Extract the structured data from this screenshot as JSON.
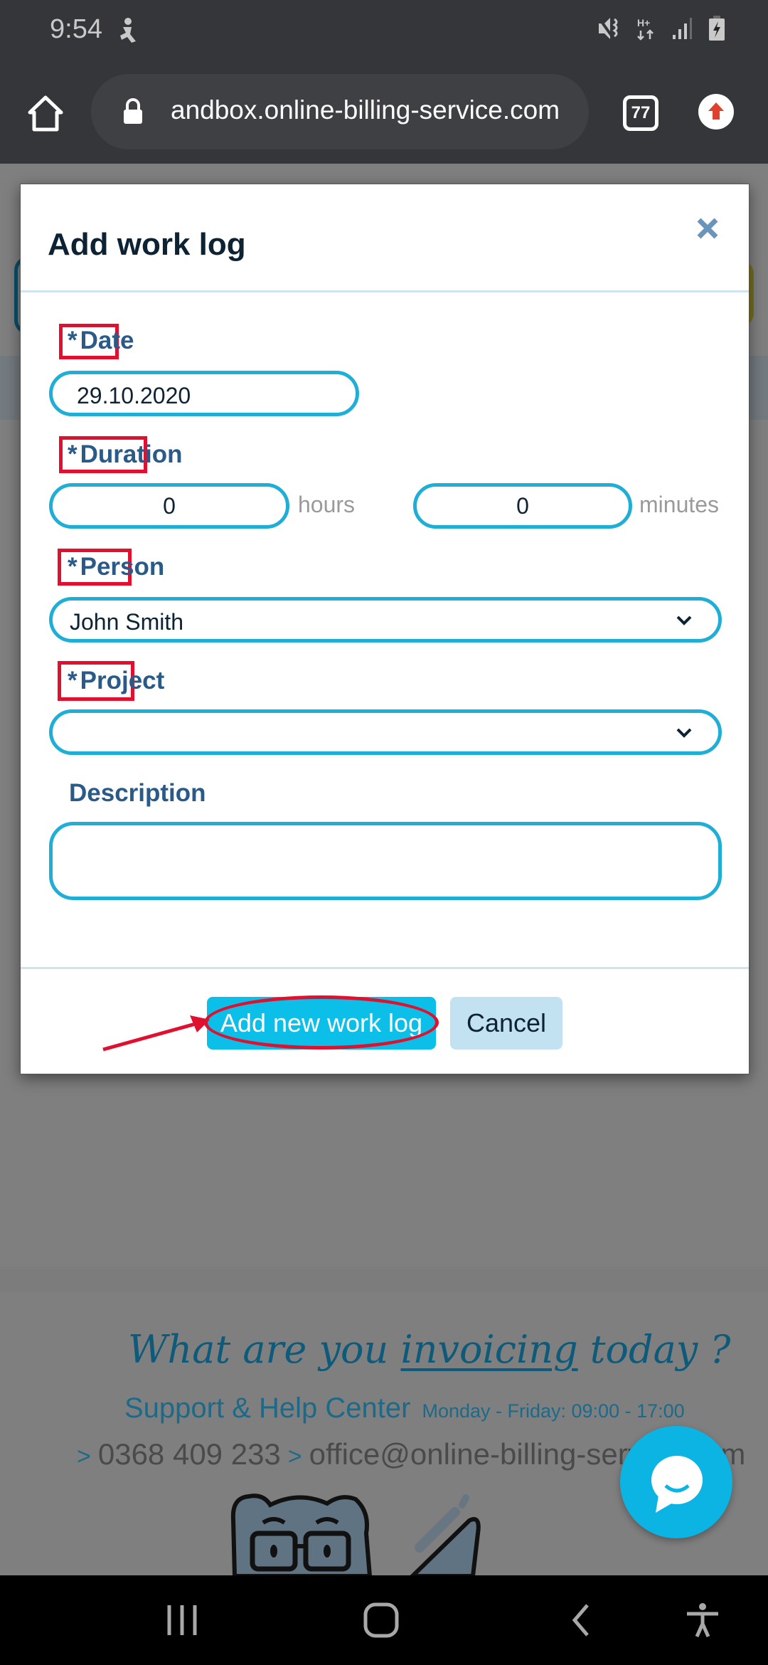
{
  "status_bar": {
    "time": "9:54",
    "left_icon": "accessibility-person-icon",
    "right_icons": [
      "vibrate-mute-icon",
      "network-hplus-icon",
      "signal-icon",
      "battery-charging-icon"
    ],
    "network_label": "H+"
  },
  "browser": {
    "home_icon": "home-icon",
    "lock_icon": "lock-icon",
    "url": "andbox.online-billing-service.com",
    "tab_count": "77",
    "update_icon": "update-arrow-icon"
  },
  "modal": {
    "title": "Add work log",
    "close_icon": "close-icon",
    "fields": {
      "date": {
        "label": "Date",
        "required_mark": "*",
        "value": "29.10.2020"
      },
      "duration": {
        "label": "Duration",
        "required_mark": "*",
        "hours_value": "0",
        "hours_unit": "hours",
        "minutes_value": "0",
        "minutes_unit": "minutes"
      },
      "person": {
        "label": "Person",
        "required_mark": "*",
        "selected": "John Smith"
      },
      "project": {
        "label": "Project",
        "required_mark": "*",
        "selected": ""
      },
      "description": {
        "label": "Description",
        "value": ""
      }
    },
    "buttons": {
      "submit": "Add new work log",
      "cancel": "Cancel"
    }
  },
  "annotations": {
    "highlight_color": "#e0102e",
    "highlighted": [
      "date-label",
      "duration-label",
      "person-label",
      "project-label",
      "add-work-log-button"
    ]
  },
  "footer": {
    "tagline_parts": [
      "What are you ",
      "invoicing",
      " today ?"
    ],
    "support_title": "Support & Help Center",
    "support_hours": "Monday - Friday: 09:00 - 17:00",
    "phone": "0368 409 233",
    "email": "office@online-billing-service.com",
    "arrow": ">"
  },
  "chat": {
    "icon": "chat-bubble-icon"
  },
  "nav_bar": {
    "buttons": [
      "recent-apps-icon",
      "home-circle-icon",
      "back-icon",
      "accessibility-icon"
    ]
  },
  "colors": {
    "accent": "#1eaed6",
    "primary_button": "#0cbfe9",
    "secondary_button": "#c2e2f2",
    "label": "#2a5a88",
    "annotation": "#e0102e"
  }
}
